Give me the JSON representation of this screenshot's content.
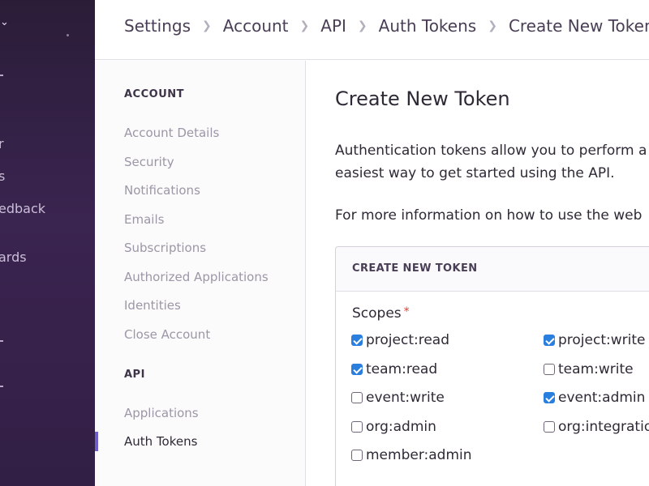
{
  "app_nav": {
    "items": [
      "r",
      "s",
      "edback",
      "ards"
    ]
  },
  "breadcrumb": {
    "items": [
      "Settings",
      "Account",
      "API",
      "Auth Tokens",
      "Create New Token"
    ]
  },
  "sidebar": {
    "sections": [
      {
        "heading": "ACCOUNT",
        "items": [
          "Account Details",
          "Security",
          "Notifications",
          "Emails",
          "Subscriptions",
          "Authorized Applications",
          "Identities",
          "Close Account"
        ]
      },
      {
        "heading": "API",
        "items": [
          "Applications",
          "Auth Tokens"
        ]
      }
    ],
    "active_item": "Auth Tokens"
  },
  "main": {
    "title": "Create New Token",
    "intro_line1": "Authentication tokens allow you to perform a",
    "intro_line2": "easiest way to get started using the API.",
    "info_line": "For more information on how to use the web",
    "panel": {
      "header": "CREATE NEW TOKEN",
      "scopes_label": "Scopes",
      "required_mark": "*",
      "scopes": [
        {
          "label": "project:read",
          "checked": true
        },
        {
          "label": "project:write",
          "checked": true
        },
        {
          "label": "team:read",
          "checked": true
        },
        {
          "label": "team:write",
          "checked": false
        },
        {
          "label": "event:write",
          "checked": false
        },
        {
          "label": "event:admin",
          "checked": true
        },
        {
          "label": "org:admin",
          "checked": false
        },
        {
          "label": "org:integratio",
          "checked": false
        },
        {
          "label": "member:admin",
          "checked": false
        }
      ]
    }
  },
  "colors": {
    "nav_bg": "#3a2450",
    "accent": "#6c5fc7",
    "checkbox_checked": "#2a7fde",
    "required": "#e03e2f"
  }
}
